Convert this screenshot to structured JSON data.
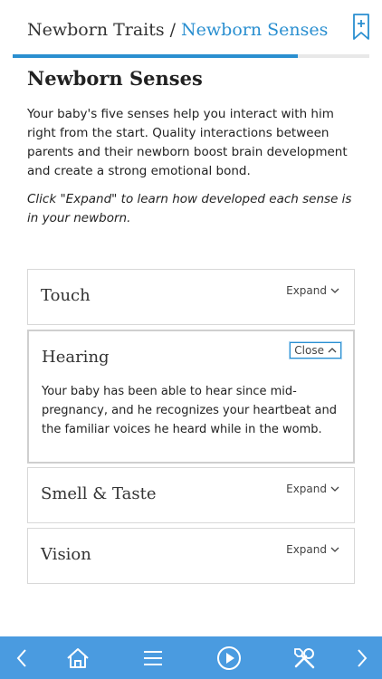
{
  "header": {
    "breadcrumb_parent": "Newborn Traits",
    "breadcrumb_separator": "/",
    "breadcrumb_current": "Newborn Senses",
    "bookmark_icon": "bookmark-add-icon",
    "progress": 0.8
  },
  "page": {
    "title": "Newborn Senses",
    "intro": "Your baby's five senses help you interact with him right from the start. Quality interactions between parents and their newborn boost brain development and create a strong emotional bond.",
    "instruction": "Click \"Expand\" to learn how developed each sense is in your newborn."
  },
  "accordion": [
    {
      "title": "Touch",
      "toggle": "Expand",
      "expanded": false
    },
    {
      "title": "Hearing",
      "toggle": "Close",
      "expanded": true,
      "body": "Your baby has been able to hear since mid-pregnancy, and he recognizes your heartbeat and the familiar voices he heard while in the womb."
    },
    {
      "title": "Smell & Taste",
      "toggle": "Expand",
      "expanded": false
    },
    {
      "title": "Vision",
      "toggle": "Expand",
      "expanded": false
    }
  ],
  "bottom_nav": [
    {
      "icon": "chevron-left-icon"
    },
    {
      "icon": "home-icon"
    },
    {
      "icon": "menu-icon"
    },
    {
      "icon": "play-icon"
    },
    {
      "icon": "tools-icon"
    },
    {
      "icon": "chevron-right-icon"
    }
  ],
  "colors": {
    "accent": "#2a8fd0",
    "nav_bar": "#4a9be0"
  }
}
